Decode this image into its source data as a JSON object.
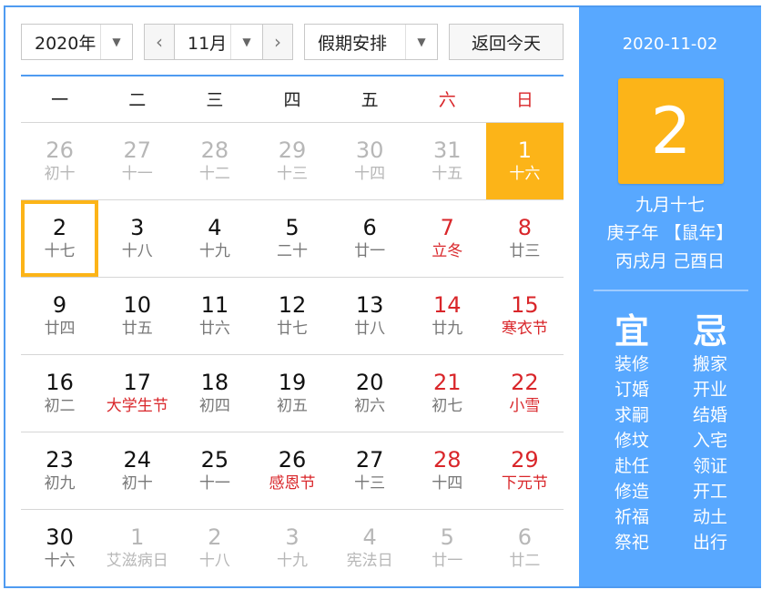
{
  "toolbar": {
    "year": "2020年",
    "prev_symbol": "‹",
    "month": "11月",
    "next_symbol": "›",
    "holiday": "假期安排",
    "today_btn": "返回今天"
  },
  "weekdays": [
    "一",
    "二",
    "三",
    "四",
    "五",
    "六",
    "日"
  ],
  "weeks": [
    [
      {
        "day": "26",
        "lunar": "初十",
        "type": "other"
      },
      {
        "day": "27",
        "lunar": "十一",
        "type": "other"
      },
      {
        "day": "28",
        "lunar": "十二",
        "type": "other"
      },
      {
        "day": "29",
        "lunar": "十三",
        "type": "other"
      },
      {
        "day": "30",
        "lunar": "十四",
        "type": "other"
      },
      {
        "day": "31",
        "lunar": "十五",
        "type": "other"
      },
      {
        "day": "1",
        "lunar": "十六",
        "type": "selected"
      }
    ],
    [
      {
        "day": "2",
        "lunar": "十七",
        "type": "today"
      },
      {
        "day": "3",
        "lunar": "十八",
        "type": "normal"
      },
      {
        "day": "4",
        "lunar": "十九",
        "type": "normal"
      },
      {
        "day": "5",
        "lunar": "二十",
        "type": "normal"
      },
      {
        "day": "6",
        "lunar": "廿一",
        "type": "normal"
      },
      {
        "day": "7",
        "lunar": "立冬",
        "type": "weekend",
        "festival": true
      },
      {
        "day": "8",
        "lunar": "廿三",
        "type": "weekend"
      }
    ],
    [
      {
        "day": "9",
        "lunar": "廿四",
        "type": "normal"
      },
      {
        "day": "10",
        "lunar": "廿五",
        "type": "normal"
      },
      {
        "day": "11",
        "lunar": "廿六",
        "type": "normal"
      },
      {
        "day": "12",
        "lunar": "廿七",
        "type": "normal"
      },
      {
        "day": "13",
        "lunar": "廿八",
        "type": "normal"
      },
      {
        "day": "14",
        "lunar": "廿九",
        "type": "weekend"
      },
      {
        "day": "15",
        "lunar": "寒衣节",
        "type": "weekend",
        "festival": true
      }
    ],
    [
      {
        "day": "16",
        "lunar": "初二",
        "type": "normal"
      },
      {
        "day": "17",
        "lunar": "大学生节",
        "type": "normal",
        "festival": true
      },
      {
        "day": "18",
        "lunar": "初四",
        "type": "normal"
      },
      {
        "day": "19",
        "lunar": "初五",
        "type": "normal"
      },
      {
        "day": "20",
        "lunar": "初六",
        "type": "normal"
      },
      {
        "day": "21",
        "lunar": "初七",
        "type": "weekend"
      },
      {
        "day": "22",
        "lunar": "小雪",
        "type": "weekend",
        "festival": true
      }
    ],
    [
      {
        "day": "23",
        "lunar": "初九",
        "type": "normal"
      },
      {
        "day": "24",
        "lunar": "初十",
        "type": "normal"
      },
      {
        "day": "25",
        "lunar": "十一",
        "type": "normal"
      },
      {
        "day": "26",
        "lunar": "感恩节",
        "type": "normal",
        "festival": true
      },
      {
        "day": "27",
        "lunar": "十三",
        "type": "normal"
      },
      {
        "day": "28",
        "lunar": "十四",
        "type": "weekend"
      },
      {
        "day": "29",
        "lunar": "下元节",
        "type": "weekend",
        "festival": true
      }
    ],
    [
      {
        "day": "30",
        "lunar": "十六",
        "type": "normal"
      },
      {
        "day": "1",
        "lunar": "艾滋病日",
        "type": "other"
      },
      {
        "day": "2",
        "lunar": "十八",
        "type": "other"
      },
      {
        "day": "3",
        "lunar": "十九",
        "type": "other"
      },
      {
        "day": "4",
        "lunar": "宪法日",
        "type": "other"
      },
      {
        "day": "5",
        "lunar": "廿一",
        "type": "other"
      },
      {
        "day": "6",
        "lunar": "廿二",
        "type": "other"
      }
    ]
  ],
  "side": {
    "date": "2020-11-02",
    "big_day": "2",
    "lunar_date": "九月十七",
    "ganzhi_year": "庚子年 【鼠年】",
    "ganzhi_month_day": "丙戌月 己酉日",
    "yi_title": "宜",
    "ji_title": "忌",
    "yi": [
      "装修",
      "订婚",
      "求嗣",
      "修坟",
      "赴任",
      "修造",
      "祈福",
      "祭祀"
    ],
    "ji": [
      "搬家",
      "开业",
      "结婚",
      "入宅",
      "领证",
      "开工",
      "动土",
      "出行"
    ]
  },
  "colors": {
    "accent_blue": "#58a8ff",
    "highlight_orange": "#fcb418",
    "holiday_red": "#d9262a",
    "muted_gray": "#b7b7b7"
  }
}
